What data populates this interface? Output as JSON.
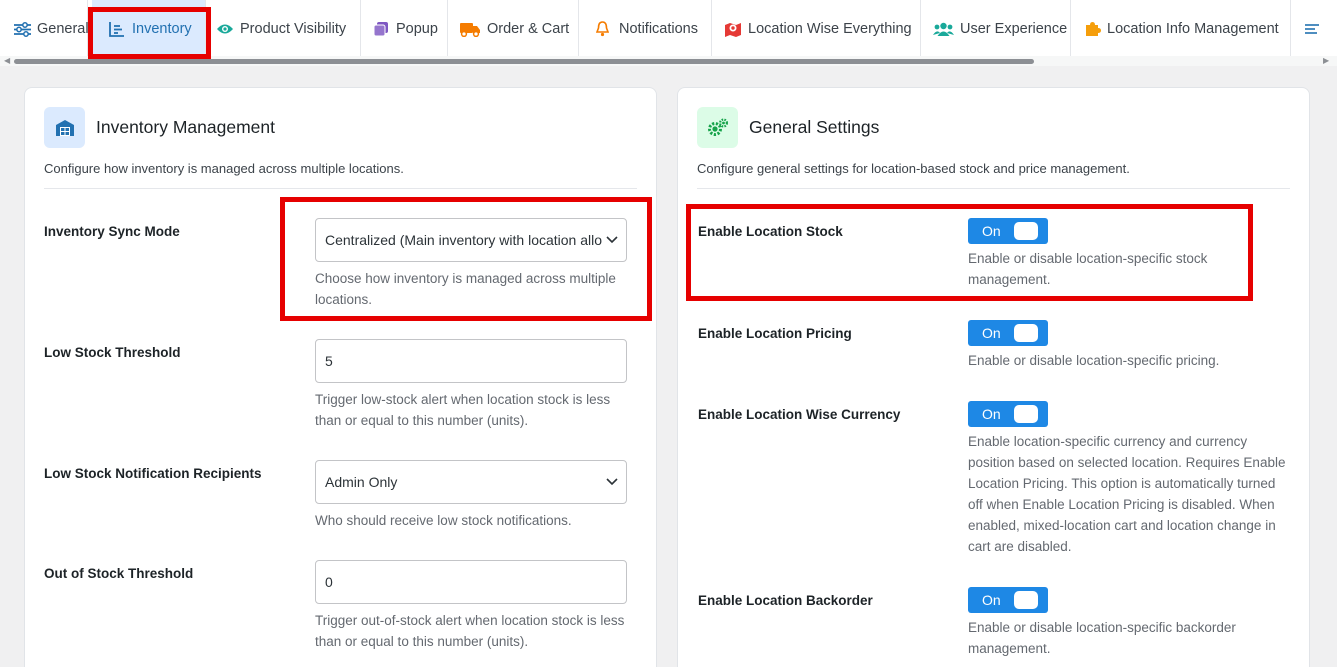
{
  "tabs": [
    {
      "label": "General",
      "icon": "sliders-icon"
    },
    {
      "label": "Inventory",
      "icon": "chart-list-icon",
      "active": true
    },
    {
      "label": "Product Visibility",
      "icon": "eye-icon"
    },
    {
      "label": "Popup",
      "icon": "popup-icon"
    },
    {
      "label": "Order & Cart",
      "icon": "truck-icon"
    },
    {
      "label": "Notifications",
      "icon": "bell-icon"
    },
    {
      "label": "Location Wise Everything",
      "icon": "map-pin-icon"
    },
    {
      "label": "User Experience",
      "icon": "users-icon"
    },
    {
      "label": "Location Info Management",
      "icon": "puzzle-icon"
    }
  ],
  "inventory": {
    "title": "Inventory Management",
    "description": "Configure how inventory is managed across multiple locations.",
    "fields": [
      {
        "label": "Inventory Sync Mode",
        "value": "Centralized (Main inventory with location allo",
        "help": "Choose how inventory is managed across multiple locations."
      },
      {
        "label": "Low Stock Threshold",
        "value": "5",
        "help": "Trigger low-stock alert when location stock is less than or equal to this number (units)."
      },
      {
        "label": "Low Stock Notification Recipients",
        "value": "Admin Only",
        "help": "Who should receive low stock notifications."
      },
      {
        "label": "Out of Stock Threshold",
        "value": "0",
        "help": "Trigger out-of-stock alert when location stock is less than or equal to this number (units)."
      }
    ]
  },
  "general": {
    "title": "General Settings",
    "description": "Configure general settings for location-based stock and price management.",
    "settings": [
      {
        "label": "Enable Location Stock",
        "state": "On",
        "help": "Enable or disable location-specific stock management."
      },
      {
        "label": "Enable Location Pricing",
        "state": "On",
        "help": "Enable or disable location-specific pricing."
      },
      {
        "label": "Enable Location Wise Currency",
        "state": "On",
        "help": "Enable location-specific currency and currency position based on selected location. Requires Enable Location Pricing. This option is automatically turned off when Enable Location Pricing is disabled. When enabled, mixed-location cart and location change in cart are disabled."
      },
      {
        "label": "Enable Location Backorder",
        "state": "On",
        "help": "Enable or disable location-specific backorder management."
      }
    ]
  },
  "colors": {
    "accent": "#2271b1",
    "toggle": "#1e88e5",
    "highlight": "#e60000",
    "active_tab_bg": "#dbeafe"
  }
}
